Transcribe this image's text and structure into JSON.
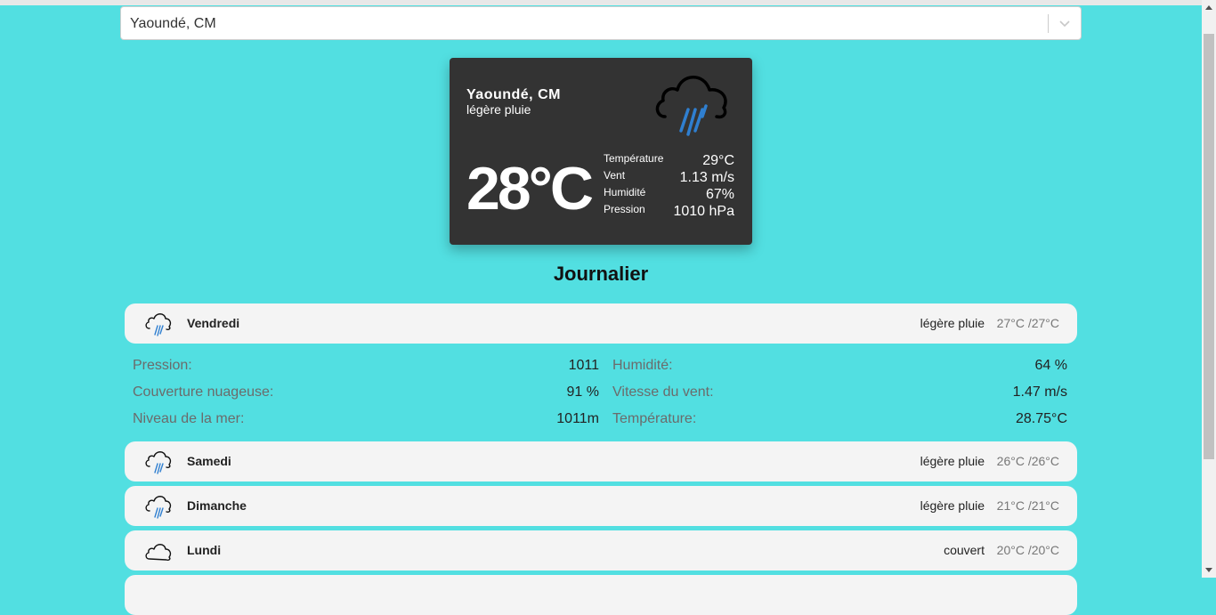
{
  "search": {
    "value": "Yaoundé, CM"
  },
  "current": {
    "city": "Yaoundé, CM",
    "description": "légère pluie",
    "temperature": "28°C",
    "icon": "rain-cloud-icon",
    "details": [
      {
        "label": "Température",
        "value": "29°C"
      },
      {
        "label": "Vent",
        "value": "1.13 m/s"
      },
      {
        "label": "Humidité",
        "value": "67%"
      },
      {
        "label": "Pression",
        "value": "1010 hPa"
      }
    ]
  },
  "daily": {
    "title": "Journalier",
    "days": [
      {
        "name": "Vendredi",
        "condition": "légère pluie",
        "range": "27°C /27°C",
        "icon": "rain-cloud-icon"
      },
      {
        "name": "Samedi",
        "condition": "légère pluie",
        "range": "26°C /26°C",
        "icon": "rain-cloud-icon"
      },
      {
        "name": "Dimanche",
        "condition": "légère pluie",
        "range": "21°C /21°C",
        "icon": "rain-cloud-icon"
      },
      {
        "name": "Lundi",
        "condition": "couvert",
        "range": "20°C /20°C",
        "icon": "cloud-icon"
      }
    ],
    "expanded": {
      "pressure_label": "Pression:",
      "pressure": "1011",
      "clouds_label": "Couverture nuageuse:",
      "clouds": "91 %",
      "sea_label": "Niveau de la mer:",
      "sea": "1011m",
      "humidity_label": "Humidité:",
      "humidity": "64 %",
      "wind_label": "Vitesse du vent:",
      "wind": "1.47 m/s",
      "temp_label": "Température:",
      "temp": "28.75°C"
    }
  },
  "colors": {
    "background": "#52dfe1",
    "card": "#333333",
    "rain": "#2f7fd0"
  }
}
